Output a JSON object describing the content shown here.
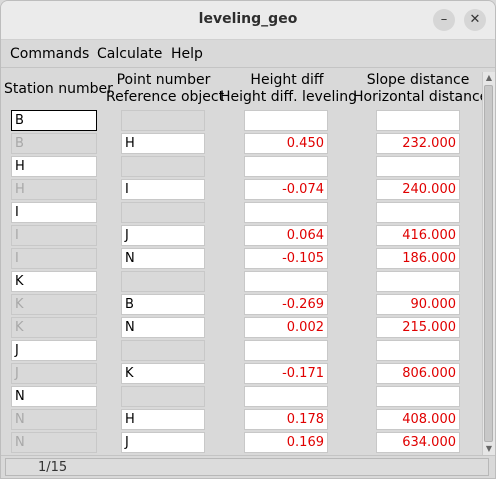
{
  "window": {
    "title": "leveling_geo",
    "minimize_glyph": "–",
    "close_glyph": "✕"
  },
  "menu": {
    "commands": "Commands",
    "calculate": "Calculate",
    "help": "Help"
  },
  "headers": {
    "station": "Station number",
    "point_1": "Point number",
    "point_2": "Reference object",
    "height_1": "Height diff",
    "height_2": "Height diff. leveling",
    "distance_1": "Slope distance",
    "distance_2": "Horizontal distance"
  },
  "rows": [
    {
      "station": "B",
      "point": "",
      "height": "",
      "distance": ""
    },
    {
      "station": "B",
      "point": "H",
      "height": "0.450",
      "distance": "232.000"
    },
    {
      "station": "H",
      "point": "",
      "height": "",
      "distance": ""
    },
    {
      "station": "H",
      "point": "I",
      "height": "-0.074",
      "distance": "240.000"
    },
    {
      "station": "I",
      "point": "",
      "height": "",
      "distance": ""
    },
    {
      "station": "I",
      "point": "J",
      "height": "0.064",
      "distance": "416.000"
    },
    {
      "station": "I",
      "point": "N",
      "height": "-0.105",
      "distance": "186.000"
    },
    {
      "station": "K",
      "point": "",
      "height": "",
      "distance": ""
    },
    {
      "station": "K",
      "point": "B",
      "height": "-0.269",
      "distance": "90.000"
    },
    {
      "station": "K",
      "point": "N",
      "height": "0.002",
      "distance": "215.000"
    },
    {
      "station": "J",
      "point": "",
      "height": "",
      "distance": ""
    },
    {
      "station": "J",
      "point": "K",
      "height": "-0.171",
      "distance": "806.000"
    },
    {
      "station": "N",
      "point": "",
      "height": "",
      "distance": ""
    },
    {
      "station": "N",
      "point": "H",
      "height": "0.178",
      "distance": "408.000"
    },
    {
      "station": "N",
      "point": "J",
      "height": "0.169",
      "distance": "634.000"
    }
  ],
  "status": {
    "text": "1/15"
  },
  "colors": {
    "value_text": "#e00000",
    "grey_cell": "#d9d9d9",
    "grey_text": "#a8a8a8"
  }
}
